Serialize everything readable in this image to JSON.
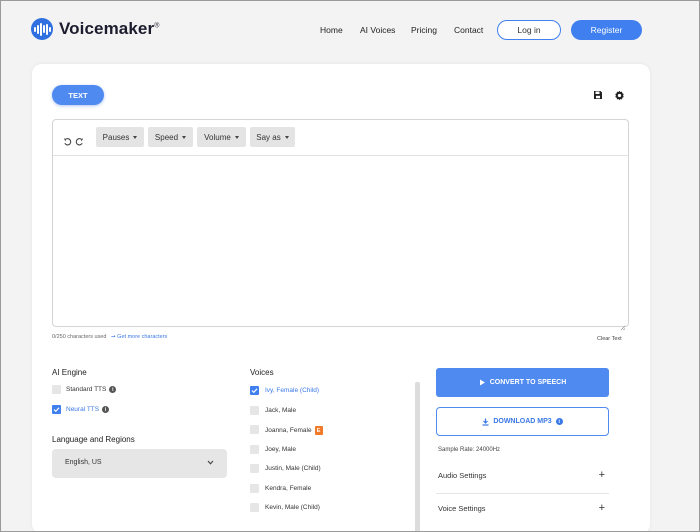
{
  "brand": {
    "name": "Voicemaker",
    "trademark": "®",
    "accent_color": "#3f7ff0",
    "logo_icon": "waveform-icon"
  },
  "nav": {
    "items": [
      {
        "label": "Home"
      },
      {
        "label": "AI Voices"
      },
      {
        "label": "Pricing"
      },
      {
        "label": "Contact"
      }
    ],
    "login_label": "Log in",
    "register_label": "Register"
  },
  "card": {
    "tab_label": "TEXT",
    "save_icon": "save-icon",
    "settings_icon": "gear-icon"
  },
  "editor": {
    "undo_icon": "undo-icon",
    "redo_icon": "redo-icon",
    "dropdowns": [
      {
        "label": "Pauses"
      },
      {
        "label": "Speed"
      },
      {
        "label": "Volume"
      },
      {
        "label": "Say as"
      }
    ],
    "text": "",
    "char_count": "0/250 characters used",
    "more_chars": "Get more characters",
    "clear_label": "Clear Text"
  },
  "engine": {
    "title": "AI Engine",
    "options": [
      {
        "label": "Standard TTS",
        "checked": false
      },
      {
        "label": "Neural TTS",
        "checked": true
      }
    ]
  },
  "language": {
    "title": "Language and Regions",
    "selected": "English, US"
  },
  "voices": {
    "title": "Voices",
    "items": [
      {
        "label": "Ivy, Female (Child)",
        "checked": true,
        "badge": ""
      },
      {
        "label": "Jack, Male",
        "checked": false,
        "badge": ""
      },
      {
        "label": "Joanna, Female",
        "checked": false,
        "badge": "E"
      },
      {
        "label": "Joey, Male",
        "checked": false,
        "badge": ""
      },
      {
        "label": "Justin, Male (Child)",
        "checked": false,
        "badge": ""
      },
      {
        "label": "Kendra, Female",
        "checked": false,
        "badge": ""
      },
      {
        "label": "Kevin, Male (Child)",
        "checked": false,
        "badge": ""
      }
    ]
  },
  "actions": {
    "convert_label": "CONVERT TO SPEECH",
    "download_label": "DOWNLOAD MP3",
    "sample_rate": "Sample Rate: 24000Hz",
    "audio_settings": "Audio Settings",
    "voice_settings": "Voice Settings"
  }
}
